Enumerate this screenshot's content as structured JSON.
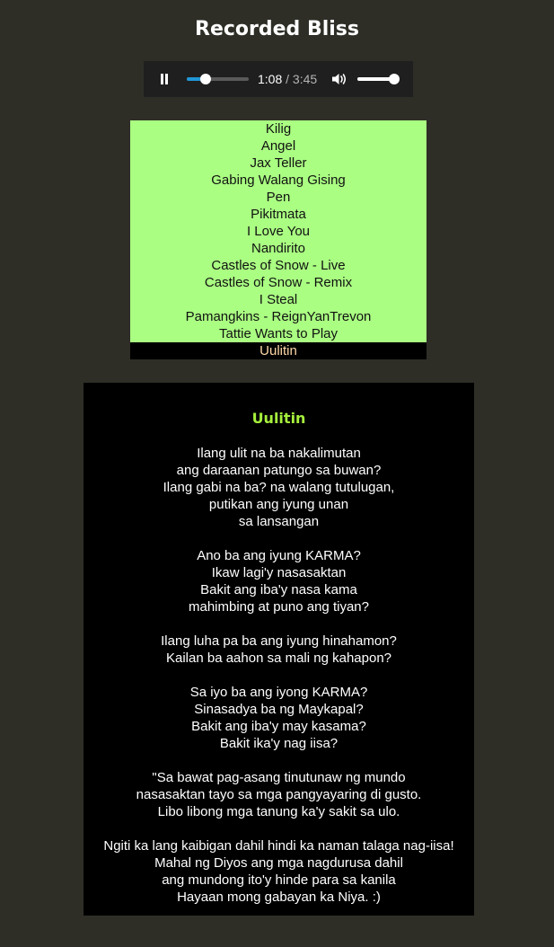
{
  "page": {
    "title": "Recorded Bliss"
  },
  "player": {
    "state": "playing",
    "current_time": "1:08",
    "separator": "/",
    "duration": "3:45",
    "progress_fraction": 0.302,
    "volume_fraction": 0.93,
    "colors": {
      "background": "#1f1f1f",
      "progress_fill": "#2196d6",
      "track": "#5a5a5a"
    },
    "icons": {
      "play_pause": "pause-icon",
      "volume": "volume-icon"
    }
  },
  "playlist": {
    "items": [
      "Kilig",
      "Angel",
      "Jax Teller",
      "Gabing Walang Gising",
      "Pen",
      "Pikitmata",
      "I Love You",
      "Nandirito",
      "Castles of Snow - Live",
      "Castles of Snow - Remix",
      "I Steal",
      "Pamangkins - ReignYanTrevon",
      "Tattie Wants to Play",
      "Uulitin"
    ],
    "active_index": 13,
    "colors": {
      "background": "#aaff82",
      "active_background": "#000000",
      "active_text": "#ffd7a8"
    }
  },
  "lyrics": {
    "song_title": "Uulitin",
    "stanzas": [
      [
        "Ilang ulit na ba nakalimutan",
        "ang daraanan patungo sa buwan?",
        "Ilang gabi na ba? na walang tutulugan,",
        "putikan ang iyung unan",
        "sa lansangan"
      ],
      [
        "Ano ba ang iyung KARMA?",
        "Ikaw lagi'y nasasaktan",
        "Bakit ang iba'y nasa kama",
        "mahimbing at puno ang tiyan?"
      ],
      [
        "Ilang luha pa ba ang iyung hinahamon?",
        "Kailan ba aahon sa mali ng kahapon?"
      ],
      [
        "Sa iyo ba ang iyong KARMA?",
        "Sinasadya ba ng Maykapal?",
        "Bakit ang iba'y may kasama?",
        "Bakit ika'y nag iisa?"
      ],
      [
        "\"Sa bawat pag-asang tinutunaw ng mundo",
        "nasasaktan tayo sa mga pangyayaring di gusto.",
        "Libo libong mga tanung ka'y sakit sa ulo."
      ],
      [
        "Ngiti ka lang kaibigan dahil hindi ka naman talaga nag-iisa!",
        "Mahal ng Diyos ang mga nagdurusa dahil",
        "ang mundong ito'y hinde para sa kanila",
        "Hayaan mong gabayan ka Niya. :)"
      ]
    ],
    "colors": {
      "title": "#a6f03c",
      "panel_background": "#000000"
    }
  },
  "colors": {
    "page_background": "#2e2e27"
  }
}
